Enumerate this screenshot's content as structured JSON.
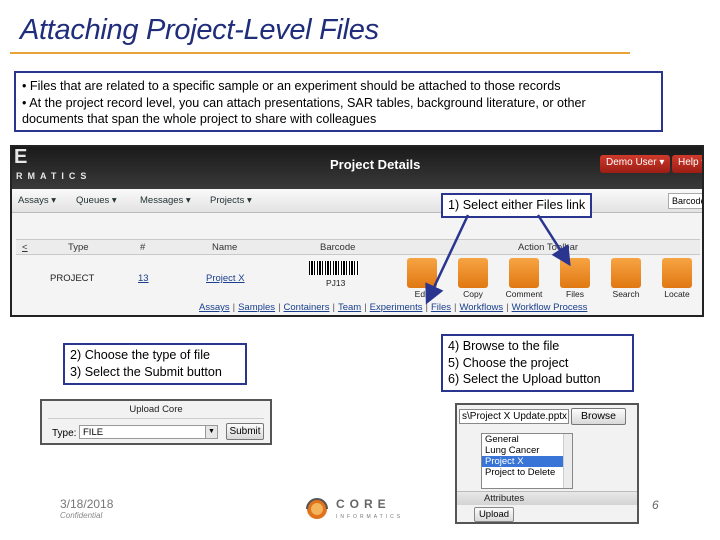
{
  "slide": {
    "title": "Attaching Project-Level Files",
    "bullets": [
      "• Files that are related to a specific sample or an experiment should be attached to those records",
      "• At the project record level, you can attach presentations, SAR tables, background literature, or other",
      "documents that span the whole project to share with colleagues"
    ]
  },
  "app": {
    "brand_letter": "E",
    "brand": "RMATICS",
    "title": "Project Details",
    "user_button": "Demo User ▾",
    "help_button": "Help ▾",
    "nav": [
      "Assays ▾",
      "Queues ▾",
      "Messages ▾",
      "Projects ▾"
    ],
    "barcode_placeholder": "Barcode",
    "table_headers": [
      "<",
      "Type",
      "#",
      "Name",
      "Barcode",
      "Action Toolbar"
    ],
    "row": {
      "type": "PROJECT",
      "number": "13",
      "name": "Project X",
      "barcode": "PJ13"
    },
    "actions": [
      {
        "label": "Edit",
        "icon": "edit-icon"
      },
      {
        "label": "Copy",
        "icon": "copy-icon"
      },
      {
        "label": "Comment",
        "icon": "comment-icon"
      },
      {
        "label": "Files",
        "icon": "files-icon"
      },
      {
        "label": "Search",
        "icon": "search-icon"
      },
      {
        "label": "Locate",
        "icon": "locate-icon"
      }
    ],
    "sublinks": [
      "Assays",
      "Samples",
      "Containers",
      "Team",
      "Experiments",
      "Files",
      "Workflows",
      "Workflow Process"
    ]
  },
  "callouts": {
    "step1": "1) Select either Files link",
    "step2": "2) Choose the type of file",
    "step3": "3) Select the Submit button",
    "step4": "4) Browse to the file",
    "step5": "5) Choose the project",
    "step6": "6) Select the Upload button"
  },
  "upload_core": {
    "title": "Upload Core",
    "type_label": "Type:",
    "type_value": "FILE",
    "submit": "Submit"
  },
  "file_panel": {
    "path": "s\\Project X Update.pptx",
    "browse": "Browse",
    "projects": [
      "General",
      "Lung Cancer",
      "Project X",
      "Project to Delete"
    ],
    "selected_project": "Project X",
    "attributes_label": "Attributes",
    "upload": "Upload"
  },
  "footer": {
    "date": "3/18/2018",
    "confidential": "Confidential",
    "logo_word": "CORE",
    "logo_sub": "INFORMATICS",
    "page": "6"
  },
  "colors": {
    "title": "#1f2d7a",
    "rule": "#e8a23a",
    "callout_border": "#2a3590",
    "arrow": "#2a3590"
  }
}
